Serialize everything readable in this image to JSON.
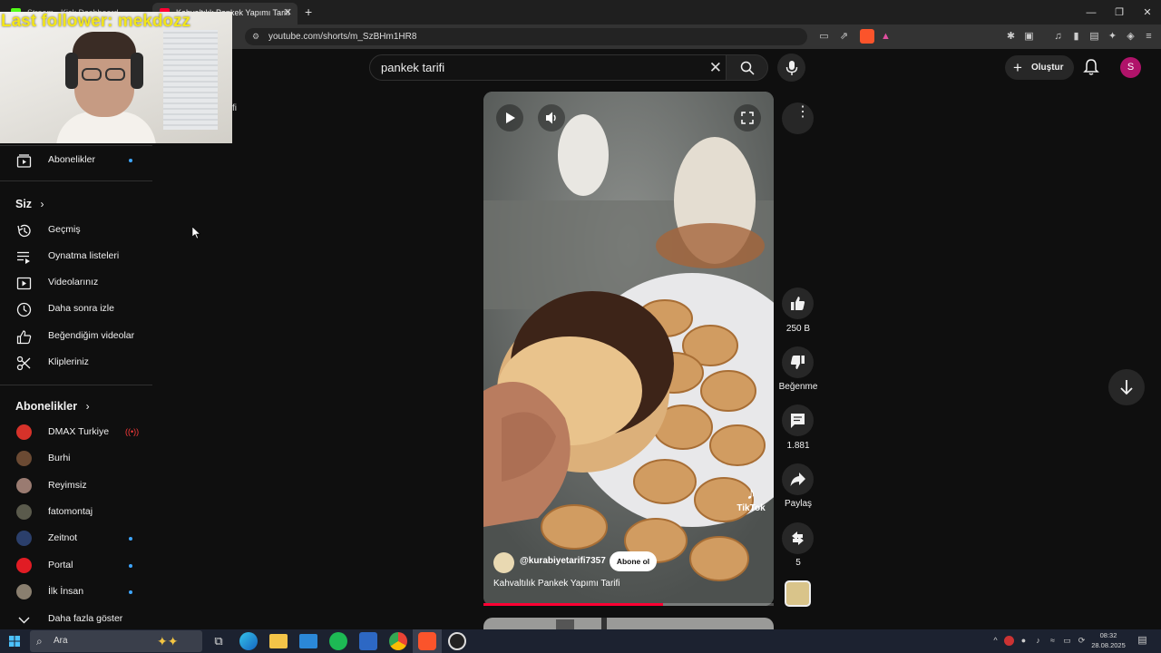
{
  "browser": {
    "tabs": [
      {
        "title": "Stream - Kick Dashboard",
        "active": false
      },
      {
        "title": "Kahvaltılık Pankek Yapımı Tarifi",
        "active": true
      }
    ],
    "url": "youtube.com/shorts/m_SzBHm1HR8"
  },
  "stream_overlay": {
    "follower_text": "Last follower: mekdozz",
    "clipped_text": "fi"
  },
  "header": {
    "search_value": "pankek tarifi",
    "create_label": "Oluştur",
    "avatar_letter": "S"
  },
  "sidebar": {
    "subscriptions_item": {
      "label": "Abonelikler",
      "dot": true
    },
    "you_heading": "Siz",
    "you_items": [
      {
        "label": "Geçmiş",
        "icon": "history-icon"
      },
      {
        "label": "Oynatma listeleri",
        "icon": "playlists-icon"
      },
      {
        "label": "Videolarınız",
        "icon": "your-videos-icon"
      },
      {
        "label": "Daha sonra izle",
        "icon": "watch-later-icon"
      },
      {
        "label": "Beğendiğim videolar",
        "icon": "liked-videos-icon"
      },
      {
        "label": "Klipleriniz",
        "icon": "clips-icon"
      }
    ],
    "subs_heading": "Abonelikler",
    "channels": [
      {
        "label": "DMAX Turkiye",
        "color": "#d6322a",
        "live": true,
        "dot": false
      },
      {
        "label": "Burhi",
        "color": "#6b4a33",
        "live": false,
        "dot": false
      },
      {
        "label": "Reyimsiz",
        "color": "#9a7b71",
        "live": false,
        "dot": false
      },
      {
        "label": "fatomontaj",
        "color": "#5a5a4c",
        "live": false,
        "dot": false
      },
      {
        "label": "Zeitnot",
        "color": "#2b3f6b",
        "live": false,
        "dot": true
      },
      {
        "label": "Portal",
        "color": "#e11c24",
        "live": false,
        "dot": true
      },
      {
        "label": "İlk İnsan",
        "color": "#8a7f6f",
        "live": false,
        "dot": true
      }
    ],
    "show_more": "Daha fazla göster"
  },
  "short": {
    "channel": "@kurabiyetarifi7357",
    "subscribe": "Abone ol",
    "title": "Kahvaltılık Pankek Yapımı Tarifi",
    "watermark": "TikTok",
    "progress": 0.62,
    "likes": "250 B",
    "dislike_label": "Beğenme",
    "comments": "1.881",
    "share_label": "Paylaş",
    "remix_count": "5"
  },
  "taskbar": {
    "search_placeholder": "Ara",
    "time": "08:32",
    "date": "28.08.2025"
  },
  "colors": {
    "accent_blue": "#3ea6ff",
    "youtube_red": "#ff0033",
    "follower_yellow": "#f2e51a",
    "avatar": "#b0136a"
  }
}
